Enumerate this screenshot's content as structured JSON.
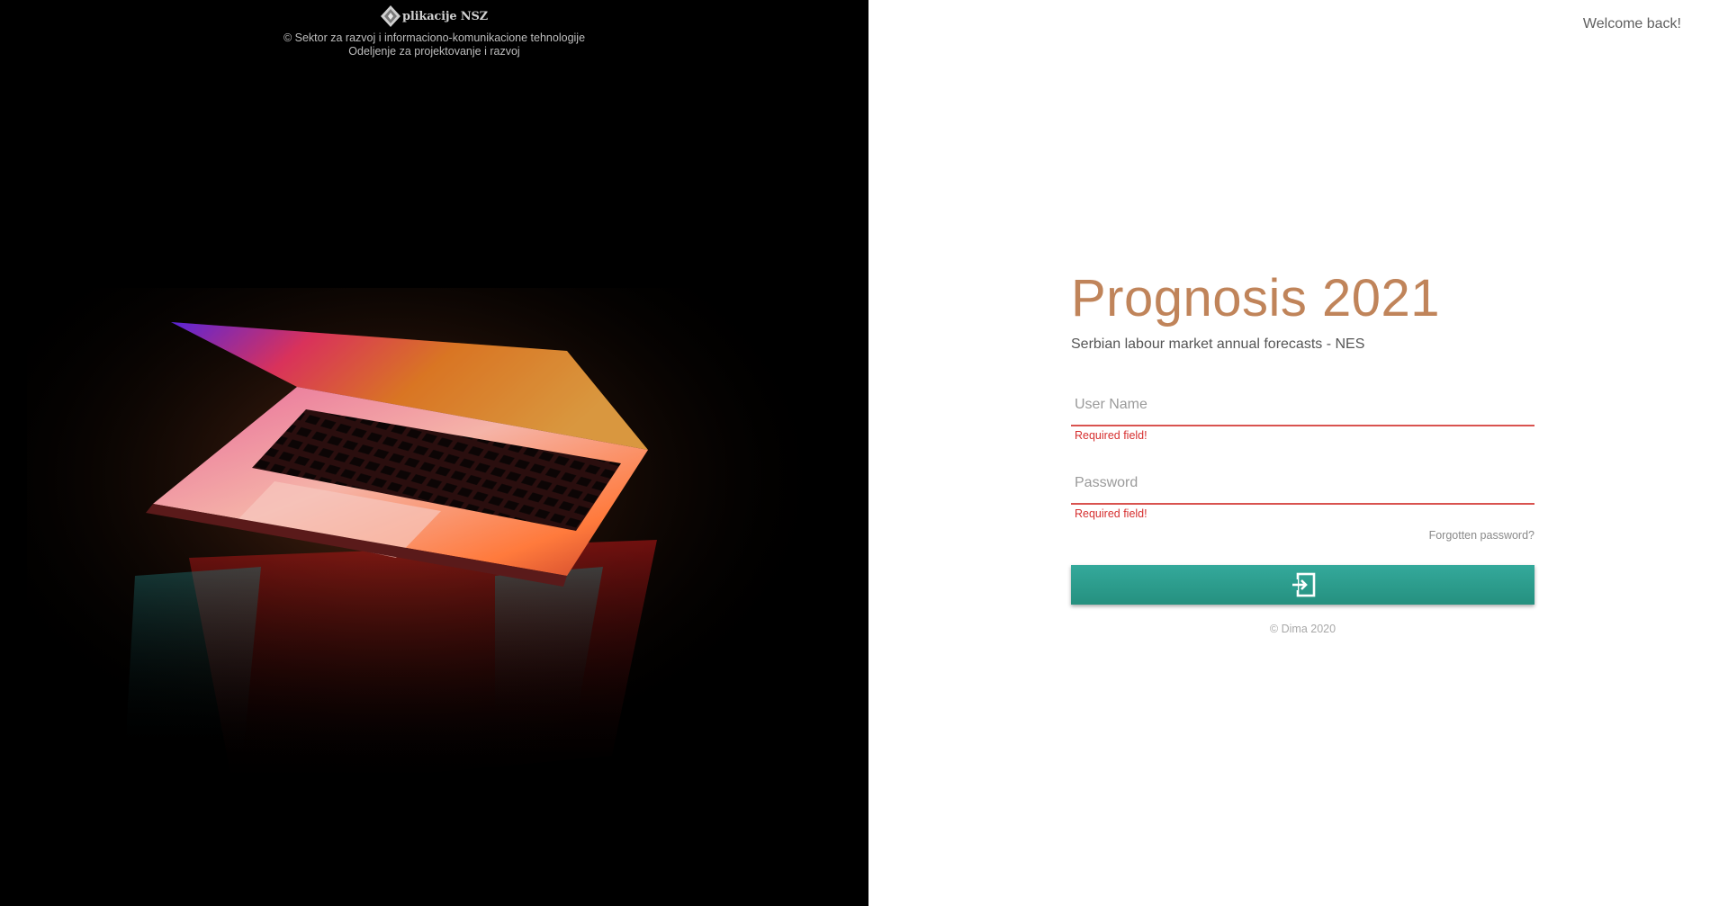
{
  "branding": {
    "logo_text": "plikacije NSZ",
    "line1": "© Sektor za razvoj i informaciono-komunikacione tehnologije",
    "line2": "Odeljenje za projektovanje i razvoj"
  },
  "header": {
    "welcome": "Welcome back!"
  },
  "login": {
    "title": "Prognosis 2021",
    "subtitle": "Serbian labour market annual forecasts - NES",
    "username": {
      "placeholder": "User Name",
      "value": "",
      "error": "Required field!"
    },
    "password": {
      "placeholder": "Password",
      "value": "",
      "error": "Required field!"
    },
    "forgot_link": "Forgotten password?",
    "submit_icon": "login-icon",
    "copyright": "© Dima 2020"
  },
  "colors": {
    "title": "#c0845a",
    "error": "#d62f2f",
    "button": "#2a9d8f",
    "left_panel": "#000000"
  }
}
